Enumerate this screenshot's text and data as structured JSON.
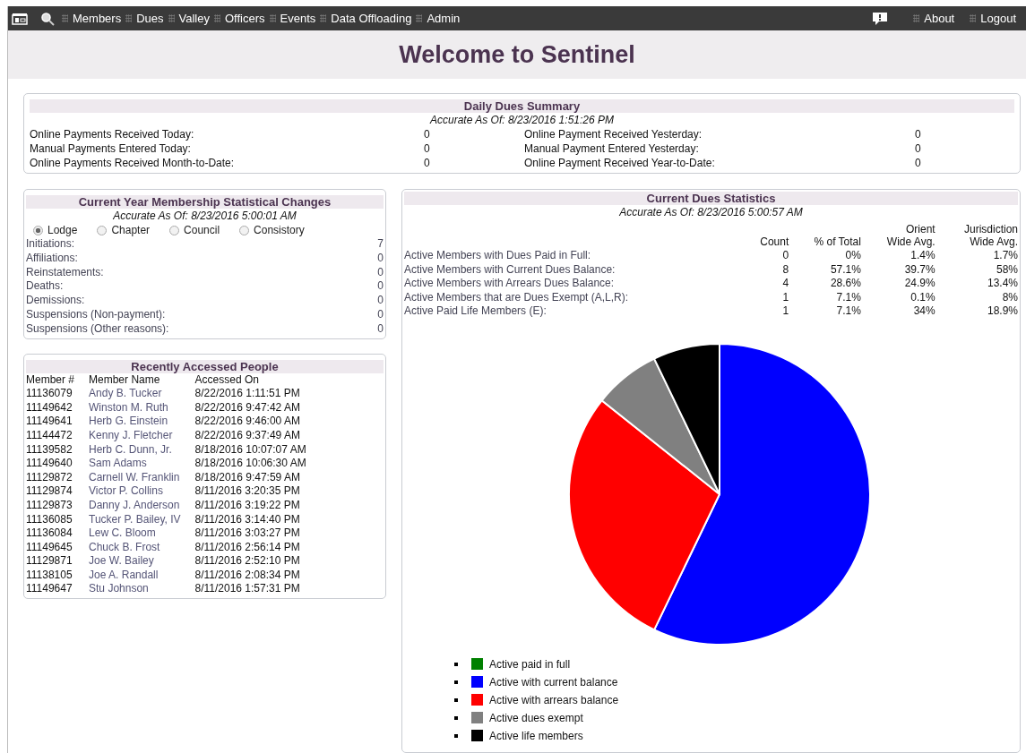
{
  "nav": {
    "items": [
      {
        "label": "Members"
      },
      {
        "label": "Dues"
      },
      {
        "label": "Valley"
      },
      {
        "label": "Officers"
      },
      {
        "label": "Events"
      },
      {
        "label": "Data Offloading"
      },
      {
        "label": "Admin"
      }
    ],
    "right_items": [
      {
        "label": "About"
      },
      {
        "label": "Logout"
      }
    ]
  },
  "page_title": "Welcome to Sentinel",
  "daily_summary": {
    "title": "Daily Dues Summary",
    "accurate": "Accurate As Of: 8/23/2016 1:51:26 PM",
    "rows": [
      {
        "left_label": "Online Payments Received Today:",
        "left_value": "0",
        "right_label": "Online Payment Received Yesterday:",
        "right_value": "0"
      },
      {
        "left_label": "Manual Payments Entered Today:",
        "left_value": "0",
        "right_label": "Manual Payment Entered Yesterday:",
        "right_value": "0"
      },
      {
        "left_label": "Online Payments Received Month-to-Date:",
        "left_value": "0",
        "right_label": "Online Payment Received Year-to-Date:",
        "right_value": "0"
      }
    ]
  },
  "membership_changes": {
    "title": "Current Year Membership Statistical Changes",
    "accurate": "Accurate As Of: 8/23/2016 5:00:01 AM",
    "options": [
      {
        "label": "Lodge",
        "selected": true
      },
      {
        "label": "Chapter",
        "selected": false
      },
      {
        "label": "Council",
        "selected": false
      },
      {
        "label": "Consistory",
        "selected": false
      }
    ],
    "rows": [
      {
        "label": "Initiations:",
        "value": "7"
      },
      {
        "label": "Affiliations:",
        "value": "0"
      },
      {
        "label": "Reinstatements:",
        "value": "0"
      },
      {
        "label": "Deaths:",
        "value": "0"
      },
      {
        "label": "Demissions:",
        "value": "0"
      },
      {
        "label": "Suspensions (Non-payment):",
        "value": "0"
      },
      {
        "label": "Suspensions (Other reasons):",
        "value": "0"
      }
    ]
  },
  "recent_people": {
    "title": "Recently Accessed People",
    "columns": [
      "Member #",
      "Member Name",
      "Accessed On"
    ],
    "rows": [
      [
        "11136079",
        "Andy B. Tucker",
        "8/22/2016 1:11:51 PM"
      ],
      [
        "11149642",
        "Winston M. Ruth",
        "8/22/2016 9:47:42 AM"
      ],
      [
        "11149641",
        "Herb G. Einstein",
        "8/22/2016 9:46:00 AM"
      ],
      [
        "11144472",
        "Kenny J. Fletcher",
        "8/22/2016 9:37:49 AM"
      ],
      [
        "11139582",
        "Herb C. Dunn, Jr.",
        "8/18/2016 10:07:07 AM"
      ],
      [
        "11149640",
        "Sam Adams",
        "8/18/2016 10:06:30 AM"
      ],
      [
        "11129872",
        "Carnell W. Franklin",
        "8/18/2016 9:47:59 AM"
      ],
      [
        "11129874",
        "Victor P. Collins",
        "8/11/2016 3:20:35 PM"
      ],
      [
        "11129873",
        "Danny J. Anderson",
        "8/11/2016 3:19:22 PM"
      ],
      [
        "11136085",
        "Tucker P. Bailey, IV",
        "8/11/2016 3:14:40 PM"
      ],
      [
        "11136084",
        "Lew C. Bloom",
        "8/11/2016 3:03:27 PM"
      ],
      [
        "11149645",
        "Chuck B. Frost",
        "8/11/2016 2:56:14 PM"
      ],
      [
        "11129871",
        "Joe W. Bailey",
        "8/11/2016 2:52:10 PM"
      ],
      [
        "11138105",
        "Joe A. Randall",
        "8/11/2016 2:08:34 PM"
      ],
      [
        "11149647",
        "Stu Johnson",
        "8/11/2016 1:57:31 PM"
      ]
    ]
  },
  "dues_stats": {
    "title": "Current Dues Statistics",
    "accurate": "Accurate As Of: 8/23/2016 5:00:57 AM",
    "columns": [
      "Count",
      "% of Total",
      "Orient\nWide Avg.",
      "Jurisdiction\nWide Avg."
    ],
    "rows": [
      {
        "label": "Active Members with Dues Paid in Full:",
        "cells": [
          "0",
          "0%",
          "1.4%",
          "1.7%"
        ]
      },
      {
        "label": "Active Members with Current Dues Balance:",
        "cells": [
          "8",
          "57.1%",
          "39.7%",
          "58%"
        ]
      },
      {
        "label": "Active Members with Arrears Dues Balance:",
        "cells": [
          "4",
          "28.6%",
          "24.9%",
          "13.4%"
        ]
      },
      {
        "label": "Active Members that are Dues Exempt (A,L,R):",
        "cells": [
          "1",
          "7.1%",
          "0.1%",
          "8%"
        ]
      },
      {
        "label": "Active Paid Life Members (E):",
        "cells": [
          "1",
          "7.1%",
          "34%",
          "18.9%"
        ]
      }
    ],
    "chart_data": {
      "type": "pie",
      "categories": [
        "Active paid in full",
        "Active with current balance",
        "Active with arrears balance",
        "Active dues exempt",
        "Active life members"
      ],
      "series": [
        {
          "values": [
            0,
            57.14,
            28.57,
            7.145,
            7.145
          ]
        }
      ],
      "colors": [
        "#008000",
        "#0000ff",
        "#ff0000",
        "#808080",
        "#000000"
      ]
    }
  }
}
